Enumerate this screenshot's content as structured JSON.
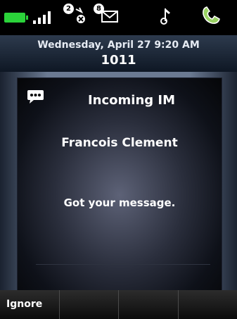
{
  "status": {
    "voicemail_count": "2",
    "message_count": "8"
  },
  "header": {
    "datetime": "Wednesday, April 27 9:20 AM",
    "extension": "1011"
  },
  "dialog": {
    "title": "Incoming IM",
    "sender": "Francois Clement",
    "message": "Got your message."
  },
  "softkeys": [
    "Ignore",
    "",
    "",
    ""
  ],
  "colors": {
    "battery": "#2bd33a",
    "header_top": "#2d3a4d",
    "header_bottom": "#0e1724"
  },
  "icons": [
    "battery-icon",
    "signal-icon",
    "missed-call-icon",
    "voicemail-icon",
    "music-note-icon",
    "phone-handset-icon",
    "chat-bubble-icon"
  ]
}
